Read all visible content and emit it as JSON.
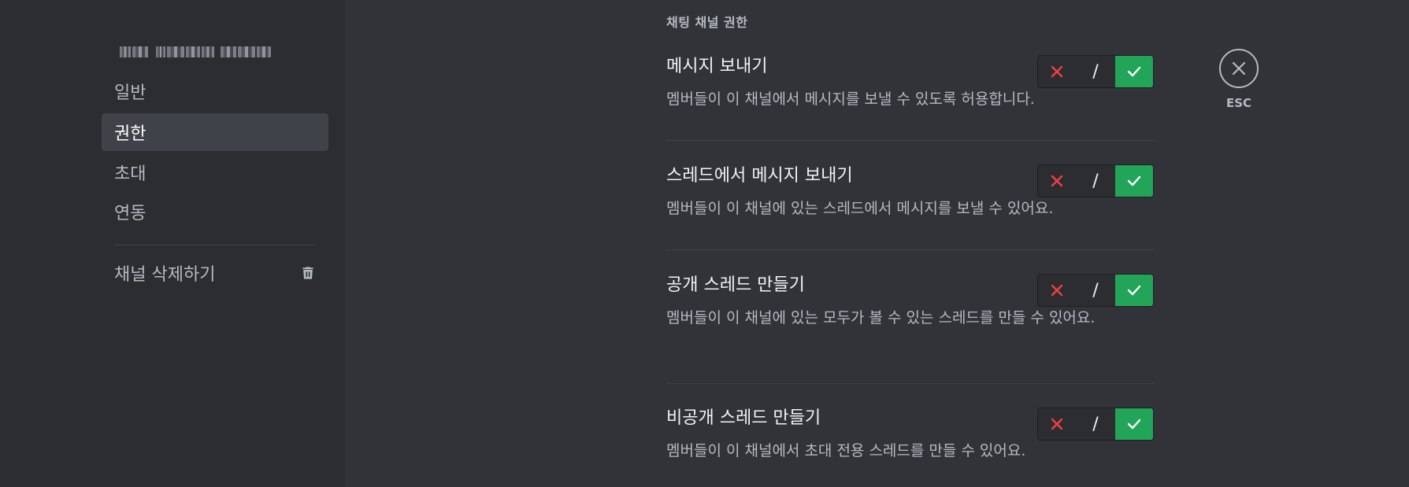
{
  "sidebar": {
    "items": [
      {
        "label": "일반",
        "active": false
      },
      {
        "label": "권한",
        "active": true
      },
      {
        "label": "초대",
        "active": false
      },
      {
        "label": "연동",
        "active": false
      }
    ],
    "delete_label": "채널 삭제하기",
    "delete_icon": "trash-icon"
  },
  "content": {
    "section_title": "채팅 채널 권한",
    "permissions": [
      {
        "title": "메시지 보내기",
        "description": "멤버들이 이 채널에서 메시지를 보낼 수 있도록 허용합니다.",
        "state": "allow"
      },
      {
        "title": "스레드에서 메시지 보내기",
        "description": "멤버들이 이 채널에 있는 스레드에서 메시지를 보낼 수 있어요.",
        "state": "allow"
      },
      {
        "title": "공개 스레드 만들기",
        "description": "멤버들이 이 채널에 있는 모두가 볼 수 있는 스레드를 만들 수 있어요.",
        "state": "allow"
      },
      {
        "title": "비공개 스레드 만들기",
        "description": "멤버들이 이 채널에서 초대 전용 스레드를 만들 수 있어요.",
        "state": "allow"
      }
    ],
    "toggle": {
      "deny_icon": "x-icon",
      "neutral_label": "/",
      "allow_icon": "check-icon"
    }
  },
  "close": {
    "label": "ESC",
    "icon": "close-icon"
  },
  "colors": {
    "sidebar_bg": "#2b2d31",
    "content_bg": "#313338",
    "active_item_bg": "#404249",
    "allow_green": "#23a559",
    "deny_red": "#f23f43"
  }
}
